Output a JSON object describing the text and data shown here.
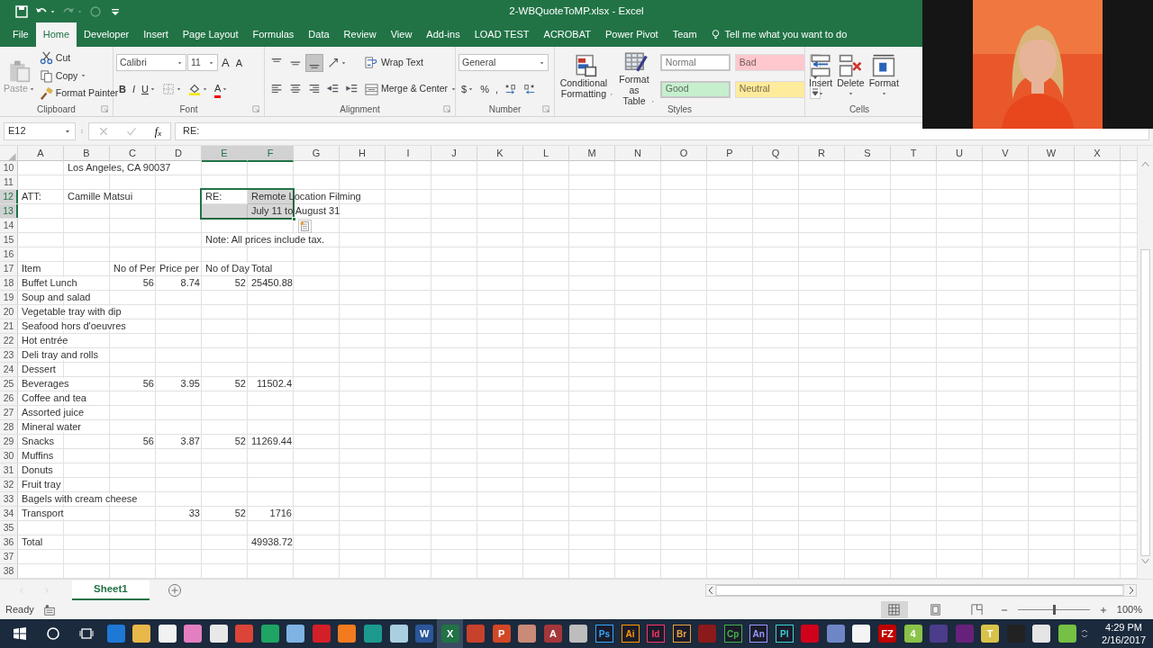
{
  "title_bar": {
    "title": "2-WBQuoteToMP.xlsx - Excel",
    "quick_access": [
      {
        "kind": "save",
        "disabled": false
      },
      {
        "kind": "undo",
        "disabled": false
      },
      {
        "kind": "redo",
        "disabled": true
      },
      {
        "kind": "touch",
        "disabled": true
      },
      {
        "kind": "customize",
        "disabled": false
      }
    ]
  },
  "tabs": [
    {
      "label": "File",
      "selected": false
    },
    {
      "label": "Home",
      "selected": true
    },
    {
      "label": "Developer",
      "selected": false
    },
    {
      "label": "Insert",
      "selected": false
    },
    {
      "label": "Page Layout",
      "selected": false
    },
    {
      "label": "Formulas",
      "selected": false
    },
    {
      "label": "Data",
      "selected": false
    },
    {
      "label": "Review",
      "selected": false
    },
    {
      "label": "View",
      "selected": false
    },
    {
      "label": "Add-ins",
      "selected": false
    },
    {
      "label": "LOAD TEST",
      "selected": false
    },
    {
      "label": "ACROBAT",
      "selected": false
    },
    {
      "label": "Power Pivot",
      "selected": false
    },
    {
      "label": "Team",
      "selected": false
    }
  ],
  "tell_me": "Tell me what you want to do",
  "ribbon": {
    "groups": [
      {
        "label": "Clipboard",
        "launcher": true,
        "columns": [
          [
            [
              {
                "kind": "paste",
                "label": "Paste",
                "disabled": true,
                "caret": true
              }
            ]
          ],
          [
            [
              {
                "kind": "cut",
                "label": "Cut"
              }
            ],
            [
              {
                "kind": "copy",
                "label": "Copy",
                "caret": true
              }
            ],
            [
              {
                "kind": "painter",
                "label": "Format Painter"
              }
            ]
          ]
        ]
      },
      {
        "label": "Font",
        "launcher": true,
        "columns": [
          [
            [
              {
                "kind": "combo",
                "value": "Calibri"
              },
              {
                "kind": "combo",
                "value": "11"
              },
              {
                "kind": "grow",
                "label": "A",
                "on": false
              },
              {
                "kind": "shrink",
                "label": "A",
                "on": false
              }
            ],
            [
              {
                "kind": "bold",
                "label": "B",
                "on": false
              },
              {
                "kind": "italic",
                "label": "I",
                "on": false
              },
              {
                "kind": "underline",
                "label": "U",
                "on": false,
                "caret": true
              },
              {
                "kind": "borders",
                "on": false,
                "caret": true
              },
              {
                "kind": "fill",
                "on": false,
                "caret": true
              },
              {
                "kind": "font_color",
                "label": "A",
                "on": false,
                "caret": true
              }
            ]
          ]
        ]
      },
      {
        "label": "Alignment",
        "launcher": true,
        "columns": [
          [
            [
              {
                "kind": "align_top",
                "on": false
              },
              {
                "kind": "align_middle",
                "on": false
              },
              {
                "kind": "align_bottom",
                "on": true
              },
              {
                "kind": "orientation",
                "on": false,
                "caret": true
              }
            ],
            [
              {
                "kind": "align_left",
                "on": false
              },
              {
                "kind": "align_center",
                "on": false
              },
              {
                "kind": "align_right",
                "on": false
              },
              {
                "kind": "outdent",
                "on": false
              },
              {
                "kind": "indent",
                "on": false
              }
            ]
          ],
          [
            [
              {
                "kind": "wrap",
                "label": "Wrap Text"
              }
            ],
            [
              {
                "kind": "merge",
                "label": "Merge & Center",
                "caret": true
              }
            ]
          ]
        ]
      },
      {
        "label": "Number",
        "launcher": true,
        "columns": [
          [
            [
              {
                "kind": "combo",
                "value": "General"
              }
            ],
            [
              {
                "kind": "currency",
                "label": "$",
                "on": false,
                "caret": true
              },
              {
                "kind": "percent",
                "label": "%",
                "on": false
              },
              {
                "kind": "comma",
                "label": ",",
                "on": false
              },
              {
                "kind": "inc_decimal",
                "on": false
              },
              {
                "kind": "dec_decimal",
                "on": false
              }
            ]
          ]
        ]
      },
      {
        "label": "Styles",
        "launcher": false,
        "columns": [
          [
            [
              {
                "kind": "conditional",
                "label": "Conditional Formatting",
                "caret": true
              }
            ]
          ],
          [
            [
              {
                "kind": "format_table",
                "label": "Format as Table",
                "caret": true
              }
            ]
          ],
          [
            [
              {
                "kind": "style",
                "label": "Normal",
                "color": "#ffffff"
              },
              {
                "kind": "style",
                "label": "Bad",
                "color": "#ffc7ce"
              }
            ],
            [
              {
                "kind": "style",
                "label": "Good",
                "color": "#c6efce"
              },
              {
                "kind": "style",
                "label": "Neutral",
                "color": "#ffeb9c"
              }
            ]
          ],
          [
            [
              {
                "kind": "gallery_scroll"
              }
            ]
          ]
        ]
      },
      {
        "label": "Cells",
        "launcher": false,
        "columns": [
          [
            [
              {
                "kind": "insert_cells",
                "label": "Insert",
                "caret": true
              }
            ]
          ],
          [
            [
              {
                "kind": "delete_cells",
                "label": "Delete",
                "caret": true
              }
            ]
          ],
          [
            [
              {
                "kind": "format_cells",
                "label": "Format",
                "caret": true
              }
            ]
          ]
        ]
      }
    ]
  },
  "formula_bar": {
    "name_box": "E12",
    "cancel_disabled": true,
    "enter_disabled": true,
    "fx": "f$_{x}$",
    "value": "RE:"
  },
  "columns": [
    {
      "label": "A",
      "selected": false
    },
    {
      "label": "B",
      "selected": false
    },
    {
      "label": "C",
      "selected": false
    },
    {
      "label": "D",
      "selected": false
    },
    {
      "label": "E",
      "selected": true
    },
    {
      "label": "F",
      "selected": true
    },
    {
      "label": "G",
      "selected": false
    },
    {
      "label": "H",
      "selected": false
    },
    {
      "label": "I",
      "selected": false
    },
    {
      "label": "J",
      "selected": false
    },
    {
      "label": "K",
      "selected": false
    },
    {
      "label": "L",
      "selected": false
    },
    {
      "label": "M",
      "selected": false
    },
    {
      "label": "N",
      "selected": false
    },
    {
      "label": "O",
      "selected": false
    },
    {
      "label": "P",
      "selected": false
    },
    {
      "label": "Q",
      "selected": false
    },
    {
      "label": "R",
      "selected": false
    },
    {
      "label": "S",
      "selected": false
    },
    {
      "label": "T",
      "selected": false
    },
    {
      "label": "U",
      "selected": false
    },
    {
      "label": "V",
      "selected": false
    },
    {
      "label": "W",
      "selected": false
    },
    {
      "label": "X",
      "selected": false
    }
  ],
  "rows": [
    {
      "number": "10",
      "selected": false,
      "cells": {
        "B": {
          "kind": "text",
          "text": "Los Angeles, CA 90037"
        }
      }
    },
    {
      "number": "11",
      "selected": false
    },
    {
      "number": "12",
      "selected": true,
      "cells": {
        "A": {
          "kind": "text",
          "text": "ATT:"
        },
        "B": {
          "kind": "text",
          "text": "Camille Matsui"
        },
        "E": {
          "kind": "text",
          "text": "RE:"
        },
        "F": {
          "kind": "text",
          "text": "Remote Location Filming"
        }
      }
    },
    {
      "number": "13",
      "selected": true,
      "cells": {
        "F": {
          "kind": "text",
          "text": "July 11 to August 31"
        }
      }
    },
    {
      "number": "14",
      "selected": false
    },
    {
      "number": "15",
      "selected": false,
      "cells": {
        "E": {
          "kind": "text",
          "text": "Note: All prices include tax."
        }
      }
    },
    {
      "number": "16",
      "selected": false
    },
    {
      "number": "17",
      "selected": false,
      "cells": {
        "A": {
          "kind": "text",
          "text": "Item"
        },
        "C": {
          "kind": "text",
          "text": "No of Per"
        },
        "D": {
          "kind": "text",
          "text": "Price per"
        },
        "E": {
          "kind": "text",
          "text": "No of Day"
        },
        "F": {
          "kind": "text",
          "text": "Total"
        }
      }
    },
    {
      "number": "18",
      "selected": false,
      "cells": {
        "A": {
          "kind": "text",
          "text": "Buffet Lunch"
        },
        "C": {
          "kind": "number",
          "text": "56"
        },
        "D": {
          "kind": "number",
          "text": "8.74"
        },
        "E": {
          "kind": "number",
          "text": "52"
        },
        "F": {
          "kind": "number",
          "text": "25450.88"
        }
      }
    },
    {
      "number": "19",
      "selected": false,
      "cells": {
        "A": {
          "kind": "text",
          "text": "Soup and salad"
        }
      }
    },
    {
      "number": "20",
      "selected": false,
      "cells": {
        "A": {
          "kind": "text",
          "text": "Vegetable tray with dip"
        }
      }
    },
    {
      "number": "21",
      "selected": false,
      "cells": {
        "A": {
          "kind": "text",
          "text": "Seafood hors d'oeuvres"
        }
      }
    },
    {
      "number": "22",
      "selected": false,
      "cells": {
        "A": {
          "kind": "text",
          "text": "Hot entrée"
        }
      }
    },
    {
      "number": "23",
      "selected": false,
      "cells": {
        "A": {
          "kind": "text",
          "text": "Deli tray and rolls"
        }
      }
    },
    {
      "number": "24",
      "selected": false,
      "cells": {
        "A": {
          "kind": "text",
          "text": "Dessert"
        }
      }
    },
    {
      "number": "25",
      "selected": false,
      "cells": {
        "A": {
          "kind": "text",
          "text": "Beverages"
        },
        "C": {
          "kind": "number",
          "text": "56"
        },
        "D": {
          "kind": "number",
          "text": "3.95"
        },
        "E": {
          "kind": "number",
          "text": "52"
        },
        "F": {
          "kind": "number",
          "text": "11502.4"
        }
      }
    },
    {
      "number": "26",
      "selected": false,
      "cells": {
        "A": {
          "kind": "text",
          "text": "Coffee and tea"
        }
      }
    },
    {
      "number": "27",
      "selected": false,
      "cells": {
        "A": {
          "kind": "text",
          "text": "Assorted juice"
        }
      }
    },
    {
      "number": "28",
      "selected": false,
      "cells": {
        "A": {
          "kind": "text",
          "text": "Mineral water"
        }
      }
    },
    {
      "number": "29",
      "selected": false,
      "cells": {
        "A": {
          "kind": "text",
          "text": "Snacks"
        },
        "C": {
          "kind": "number",
          "text": "56"
        },
        "D": {
          "kind": "number",
          "text": "3.87"
        },
        "E": {
          "kind": "number",
          "text": "52"
        },
        "F": {
          "kind": "number",
          "text": "11269.44"
        }
      }
    },
    {
      "number": "30",
      "selected": false,
      "cells": {
        "A": {
          "kind": "text",
          "text": "Muffins"
        }
      }
    },
    {
      "number": "31",
      "selected": false,
      "cells": {
        "A": {
          "kind": "text",
          "text": "Donuts"
        }
      }
    },
    {
      "number": "32",
      "selected": false,
      "cells": {
        "A": {
          "kind": "text",
          "text": "Fruit tray"
        }
      }
    },
    {
      "number": "33",
      "selected": false,
      "cells": {
        "A": {
          "kind": "text",
          "text": "Bagels with cream cheese"
        }
      }
    },
    {
      "number": "34",
      "selected": false,
      "cells": {
        "A": {
          "kind": "text",
          "text": "Transport"
        },
        "D": {
          "kind": "number",
          "text": "33"
        },
        "E": {
          "kind": "number",
          "text": "52"
        },
        "F": {
          "kind": "number",
          "text": "1716"
        }
      }
    },
    {
      "number": "35",
      "selected": false
    },
    {
      "number": "36",
      "selected": false,
      "cells": {
        "A": {
          "kind": "text",
          "text": "Total"
        },
        "F": {
          "kind": "number",
          "text": "49938.72"
        }
      }
    },
    {
      "number": "37",
      "selected": false
    },
    {
      "number": "38",
      "selected": false
    }
  ],
  "sheet_tabs": [
    {
      "label": "Sheet1",
      "selected": true
    }
  ],
  "status_bar": {
    "text": "Ready",
    "views": [
      {
        "kind": "normal",
        "selected": true
      },
      {
        "kind": "page_layout",
        "selected": false
      },
      {
        "kind": "page_break",
        "selected": false
      }
    ],
    "zoom": {
      "level": 0.5,
      "reading": "100%"
    }
  },
  "taskbar": {
    "items": [
      {
        "kind": "start"
      },
      {
        "kind": "cortana"
      },
      {
        "kind": "taskview"
      },
      {
        "kind": "app",
        "color": "#1e78d6",
        "selected": false
      },
      {
        "kind": "app",
        "color": "#e8b84a",
        "selected": false
      },
      {
        "kind": "app",
        "color": "#f2f2f2",
        "selected": false
      },
      {
        "kind": "app",
        "color": "#e37fc0",
        "selected": false
      },
      {
        "kind": "app",
        "color": "#e8e8e8",
        "selected": false
      },
      {
        "kind": "app",
        "color": "#db4437",
        "selected": false
      },
      {
        "kind": "app",
        "color": "#1fa463",
        "selected": false
      },
      {
        "kind": "app",
        "color": "#7fb3e3",
        "selected": false
      },
      {
        "kind": "app",
        "color": "#d31f27",
        "selected": false
      },
      {
        "kind": "app",
        "color": "#f27b20",
        "selected": false
      },
      {
        "kind": "app",
        "color": "#1c9a8e",
        "selected": false
      },
      {
        "kind": "app",
        "color": "#a9cfe0",
        "selected": false
      },
      {
        "kind": "app",
        "color": "#2b579a",
        "label": "W",
        "selected": false
      },
      {
        "kind": "app",
        "color": "#217346",
        "label": "X",
        "selected": true
      },
      {
        "kind": "app",
        "color": "#c8412c",
        "selected": false
      },
      {
        "kind": "app",
        "color": "#d24726",
        "label": "P",
        "selected": false
      },
      {
        "kind": "app",
        "color": "#c98a78",
        "selected": false
      },
      {
        "kind": "app",
        "color": "#a4373a",
        "label": "A",
        "selected": false
      },
      {
        "kind": "app",
        "color": "#bdbdbd",
        "selected": false
      },
      {
        "kind": "adobe",
        "color": "#31a8ff",
        "label": "Ps",
        "selected": false
      },
      {
        "kind": "adobe",
        "color": "#ff9a00",
        "label": "Ai",
        "selected": false
      },
      {
        "kind": "adobe",
        "color": "#ff3366",
        "label": "Id",
        "selected": false
      },
      {
        "kind": "adobe",
        "color": "#e8a33d",
        "label": "Br",
        "selected": false
      },
      {
        "kind": "app",
        "color": "#8b1a1a",
        "selected": false
      },
      {
        "kind": "adobe",
        "color": "#43b14b",
        "label": "Cp",
        "selected": false
      },
      {
        "kind": "adobe",
        "color": "#9999ff",
        "label": "An",
        "selected": false
      },
      {
        "kind": "adobe",
        "color": "#3bd1d7",
        "label": "Pl",
        "selected": false
      },
      {
        "kind": "app",
        "color": "#d0021b",
        "selected": false
      },
      {
        "kind": "app",
        "color": "#6f86c6",
        "selected": false
      },
      {
        "kind": "app",
        "color": "#f4f4f4",
        "selected": false
      },
      {
        "kind": "app",
        "color": "#bf0000",
        "label": "FZ",
        "selected": false
      },
      {
        "kind": "app",
        "color": "#8bc34a",
        "label": "4",
        "selected": false
      },
      {
        "kind": "app",
        "color": "#4b3c8c",
        "selected": false
      },
      {
        "kind": "app",
        "color": "#68217a",
        "selected": false
      },
      {
        "kind": "app",
        "color": "#d9c24a",
        "label": "T",
        "selected": false
      },
      {
        "kind": "app",
        "color": "#222222",
        "selected": false
      },
      {
        "kind": "app",
        "color": "#e5e5e5",
        "selected": false
      },
      {
        "kind": "app",
        "color": "#76c043",
        "selected": false
      }
    ],
    "time": "4:29 PM",
    "date": "2/16/2017"
  }
}
